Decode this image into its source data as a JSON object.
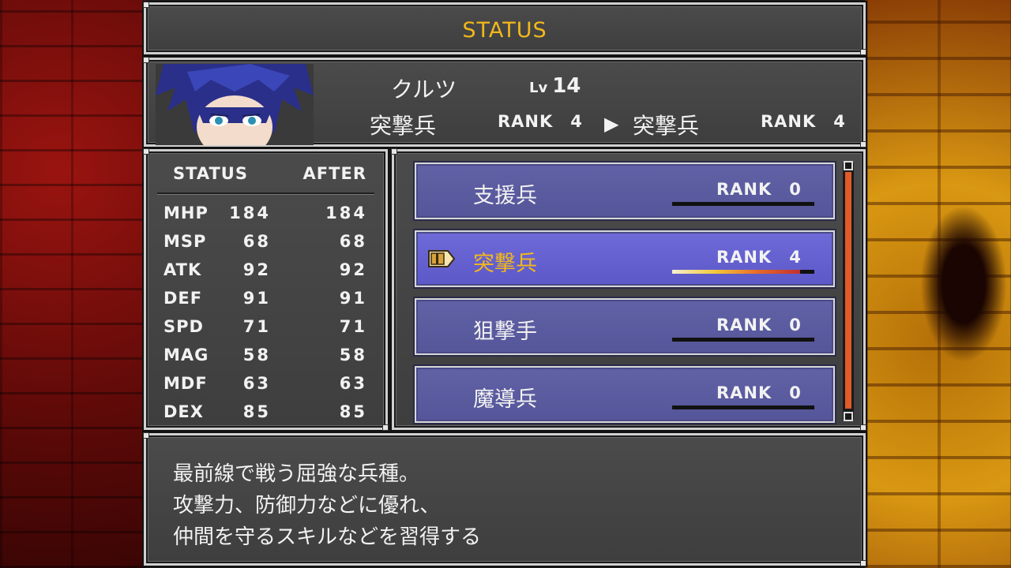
{
  "title": "STATUS",
  "character": {
    "name": "クルツ",
    "level_prefix": "Lv",
    "level": "14",
    "current_class": "突撃兵",
    "current_rank_label": "RANK",
    "current_rank": "4",
    "new_class": "突撃兵",
    "new_rank_label": "RANK",
    "new_rank": "4"
  },
  "stats": {
    "header_status": "STATUS",
    "header_after": "AFTER",
    "rows": [
      {
        "label": "MHP",
        "value": "184",
        "after": "184"
      },
      {
        "label": "MSP",
        "value": "68",
        "after": "68"
      },
      {
        "label": "ATK",
        "value": "92",
        "after": "92"
      },
      {
        "label": "DEF",
        "value": "91",
        "after": "91"
      },
      {
        "label": "SPD",
        "value": "71",
        "after": "71"
      },
      {
        "label": "MAG",
        "value": "58",
        "after": "58"
      },
      {
        "label": "MDF",
        "value": "63",
        "after": "63"
      },
      {
        "label": "DEX",
        "value": "85",
        "after": "85"
      }
    ]
  },
  "classes": [
    {
      "name": "支援兵",
      "rank_label": "RANK",
      "rank": "0",
      "progress": 0,
      "selected": false
    },
    {
      "name": "突撃兵",
      "rank_label": "RANK",
      "rank": "4",
      "progress": 0.9,
      "selected": true
    },
    {
      "name": "狙撃手",
      "rank_label": "RANK",
      "rank": "0",
      "progress": 0,
      "selected": false
    },
    {
      "name": "魔導兵",
      "rank_label": "RANK",
      "rank": "0",
      "progress": 0,
      "selected": false
    }
  ],
  "description": {
    "lines": [
      "最前線で戦う屈強な兵種。",
      "攻撃力、防御力などに優れ、",
      "仲間を守るスキルなどを習得する"
    ]
  },
  "colors": {
    "accent": "#f3b81a",
    "selected_item": "#5c58c8",
    "item": "#55559a",
    "scroll_thumb": "#e05a2a"
  }
}
